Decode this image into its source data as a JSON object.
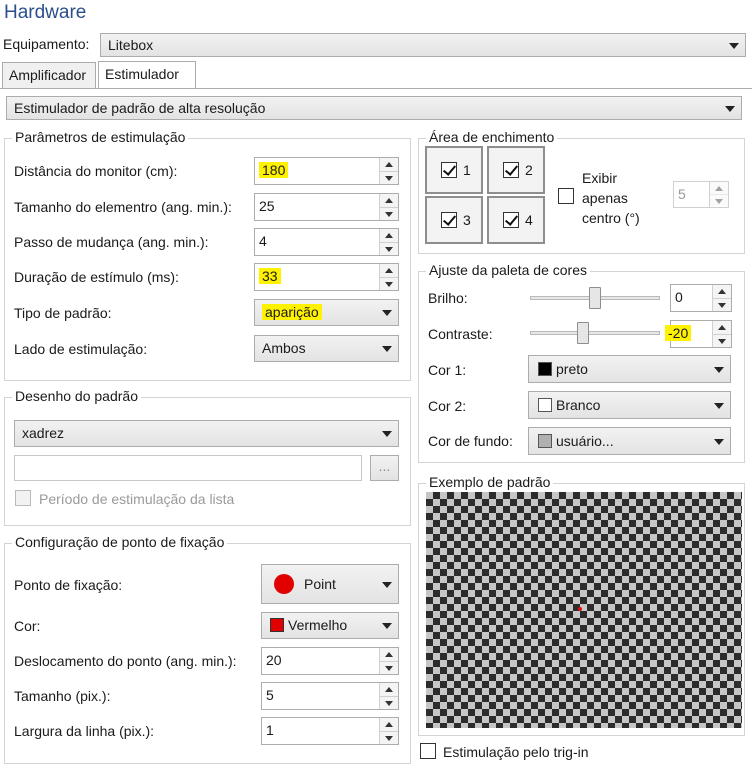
{
  "app": {
    "title": "Hardware"
  },
  "equipment": {
    "label": "Equipamento:",
    "value": "Litebox"
  },
  "tabs": [
    {
      "label": "Amplificador"
    },
    {
      "label": "Estimulador"
    }
  ],
  "stimulator_type": "Estimulador de padrão de alta resolução",
  "stim_params": {
    "title": "Parâmetros de estimulação",
    "monitor_distance": {
      "label": "Distância do monitor (cm):",
      "value": "180"
    },
    "element_size": {
      "label": "Tamanho do elementro (ang. min.):",
      "value": "25"
    },
    "change_step": {
      "label": "Passo de mudança (ang. min.):",
      "value": "4"
    },
    "stim_duration": {
      "label": "Duração de estímulo (ms):",
      "value": "33"
    },
    "pattern_type": {
      "label": "Tipo de padrão:",
      "value": "aparição"
    },
    "stim_side": {
      "label": "Lado de estimulação:",
      "value": "Ambos"
    }
  },
  "pattern_design": {
    "title": "Desenho do padrão",
    "value": "xadrez",
    "file_path": "",
    "browse_label": "...",
    "list_period_label": "Período de estimulação da lista"
  },
  "fixation": {
    "title": "Configuração de ponto de fixação",
    "point": {
      "label": "Ponto de fixação:",
      "value": "Point"
    },
    "color": {
      "label": "Cor:",
      "value": "Vermelho",
      "swatch": "#e00000"
    },
    "offset": {
      "label": "Deslocamento do ponto (ang. min.):",
      "value": "20"
    },
    "size": {
      "label": "Tamanho (pix.):",
      "value": "5"
    },
    "line_width": {
      "label": "Largura da linha (pix.):",
      "value": "1"
    }
  },
  "fill_area": {
    "title": "Área de enchimento",
    "quadrants": [
      {
        "n": "1"
      },
      {
        "n": "2"
      },
      {
        "n": "3"
      },
      {
        "n": "4"
      }
    ],
    "center_only_label": "Exibir apenas centro (°)",
    "center_value": "5"
  },
  "palette": {
    "title": "Ajuste da paleta de cores",
    "brightness": {
      "label": "Brilho:",
      "value": "0",
      "level": 0.5
    },
    "contrast": {
      "label": "Contraste:",
      "value": "-20",
      "level": 0.4
    },
    "color1": {
      "label": "Cor 1:",
      "value": "preto",
      "swatch": "#000000"
    },
    "color2": {
      "label": "Cor 2:",
      "value": "Branco",
      "swatch": "#ffffff"
    },
    "background": {
      "label": "Cor de fundo:",
      "value": "usuário...",
      "swatch": "#b0b0b0"
    }
  },
  "example": {
    "title": "Exemplo de padrão"
  },
  "trigger": {
    "label": "Estimulação pelo trig-in"
  },
  "colors": {
    "highlight": "#fff200",
    "title": "#2b4f8c",
    "fixation_red": "#e00000"
  }
}
